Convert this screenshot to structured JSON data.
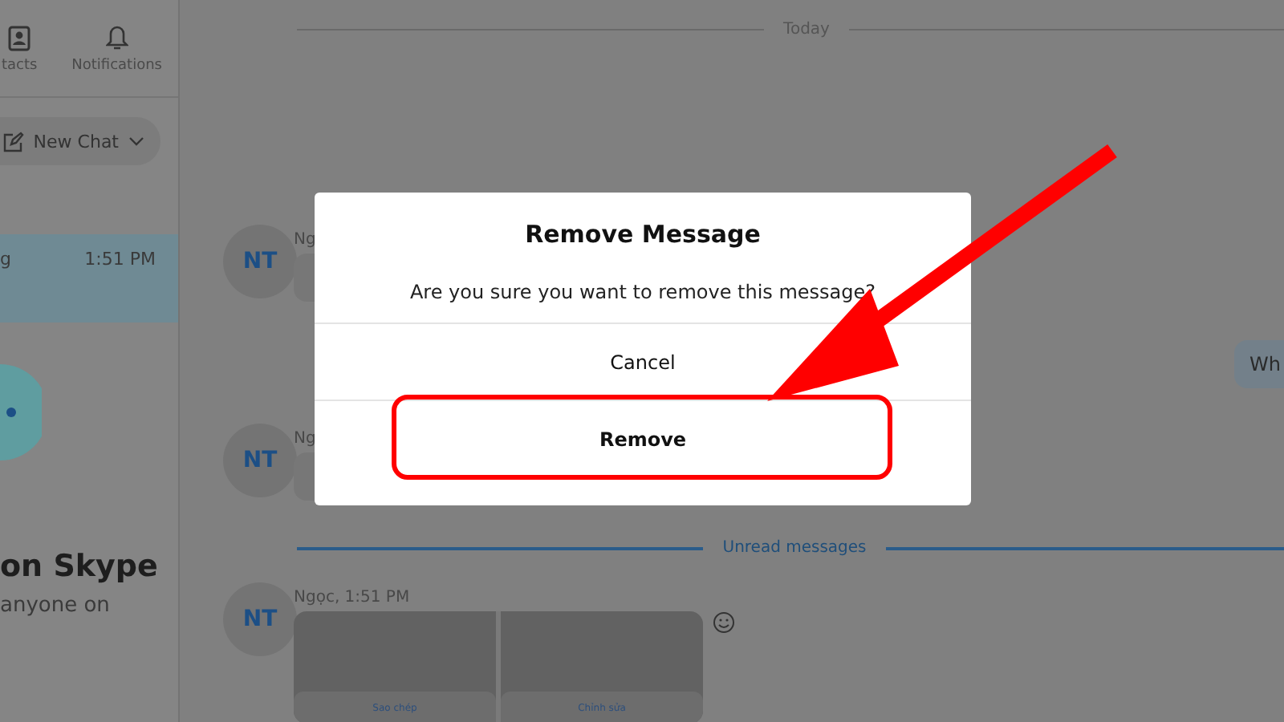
{
  "sidebar": {
    "tabs": [
      {
        "label": "tacts"
      },
      {
        "label": "Notifications"
      }
    ],
    "new_chat": {
      "label": "New Chat"
    },
    "chats": [
      {
        "name": "g",
        "time": "1:51 PM",
        "selected": true
      }
    ],
    "promo": {
      "title": "on Skype",
      "text": "anyone on"
    }
  },
  "chat": {
    "date_divider": "Today",
    "messages": [
      {
        "kind": "text",
        "avatar": "NT",
        "sender": "Ng"
      },
      {
        "kind": "outgoing",
        "text": "Wh"
      },
      {
        "kind": "text",
        "avatar": "NT",
        "sender": "Ng"
      },
      {
        "kind": "divider",
        "text": "Unread messages"
      },
      {
        "kind": "images",
        "avatar": "NT",
        "sender": "Ngọc, 1:51 PM",
        "tiles": [
          "Sao chép",
          "Chỉnh sửa"
        ]
      }
    ]
  },
  "dialog": {
    "title": "Remove Message",
    "text": "Are you sure you want to remove this message?",
    "buttons": [
      {
        "label": "Cancel",
        "primary": false,
        "highlighted": false
      },
      {
        "label": "Remove",
        "primary": true,
        "highlighted": true
      }
    ]
  }
}
